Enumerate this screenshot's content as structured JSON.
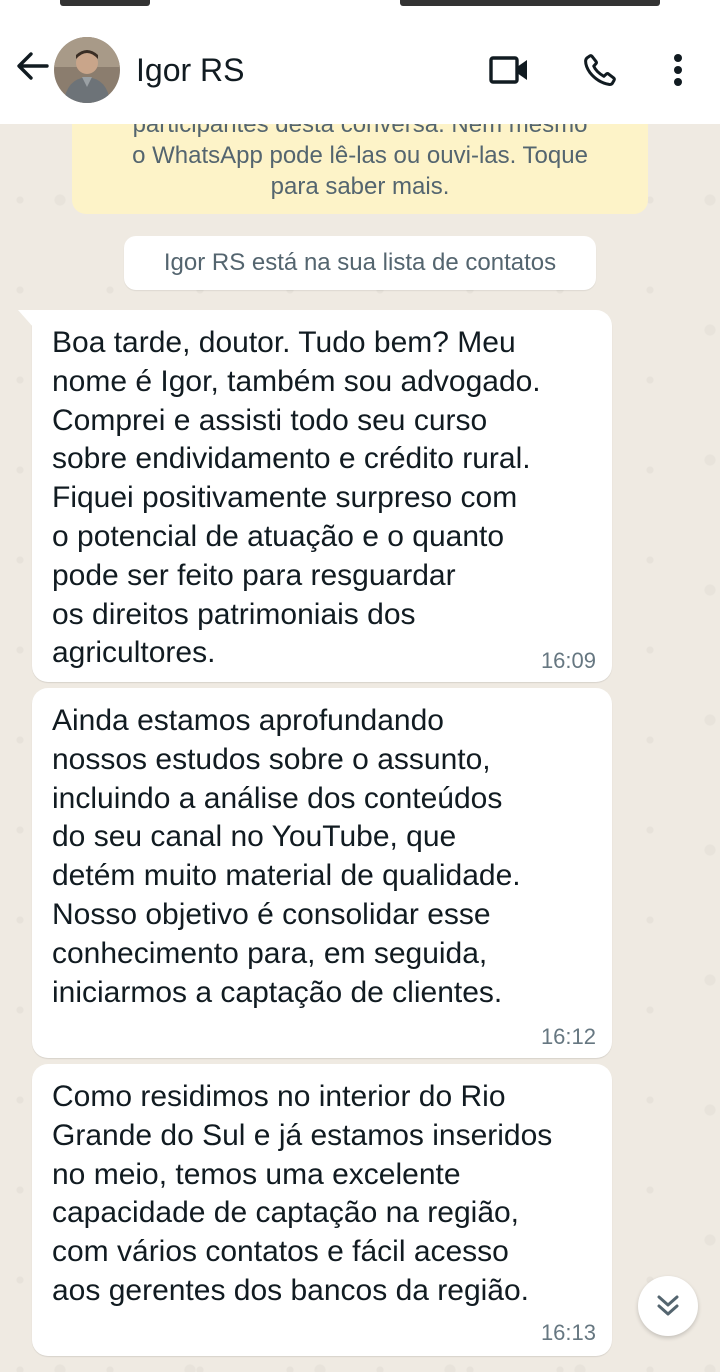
{
  "header": {
    "contact_name": "Igor RS",
    "icons": {
      "back": "arrow-left-icon",
      "video": "video-call-icon",
      "voice": "phone-icon",
      "menu": "more-vert-icon"
    },
    "accent": "#111b21"
  },
  "encryption_banner": {
    "lines": [
      "participantes desta conversa. Nem mesmo",
      "o WhatsApp pode lê-las ou ouvi-las. Toque",
      "para saber mais."
    ],
    "background": "#fdf3c8"
  },
  "contact_notice": "Igor RS está na sua lista de contatos",
  "messages": [
    {
      "lines": [
        "Boa tarde, doutor. Tudo bem? Meu",
        "nome é Igor, também sou advogado.",
        "Comprei e assisti todo seu curso",
        "sobre endividamento e crédito rural.",
        "Fiquei positivamente surpreso com",
        "o potencial de atuação e o quanto",
        "pode ser feito para resguardar",
        "os direitos patrimoniais dos",
        "agricultores."
      ],
      "time": "16:09"
    },
    {
      "lines": [
        "Ainda estamos aprofundando",
        "nossos estudos sobre o assunto,",
        "incluindo a análise dos conteúdos",
        "do seu canal no YouTube, que",
        "detém muito material de qualidade.",
        "Nosso objetivo é consolidar esse",
        "conhecimento para, em seguida,",
        "iniciarmos a captação de clientes."
      ],
      "time": "16:12"
    },
    {
      "lines": [
        "Como residimos no interior do Rio",
        "Grande do Sul e já estamos inseridos",
        "no meio, temos uma excelente",
        "capacidade de captação na região,",
        "com vários contatos e fácil acesso",
        "aos gerentes dos bancos da região."
      ],
      "time": "16:13"
    }
  ],
  "scroll_button_icon": "double-chevron-down-icon",
  "colors": {
    "chat_background": "#efeae2",
    "bubble": "#ffffff",
    "time": "#667781"
  }
}
